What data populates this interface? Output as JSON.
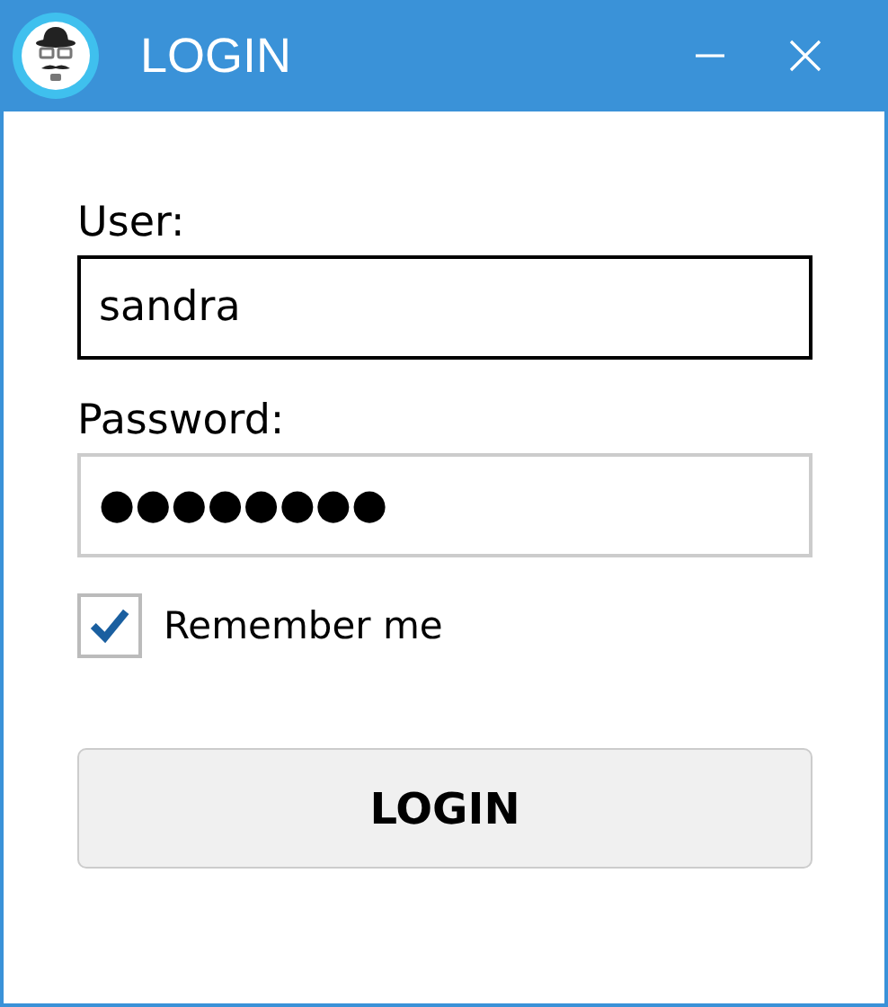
{
  "window": {
    "title": "LOGIN"
  },
  "fields": [
    {
      "label": "User:",
      "value": "sandra",
      "focused": true
    },
    {
      "label": "Password:",
      "value": "●●●●●●●●",
      "focused": false
    }
  ],
  "remember": {
    "label": "Remember me",
    "checked": true
  },
  "button": {
    "label": "LOGIN"
  }
}
